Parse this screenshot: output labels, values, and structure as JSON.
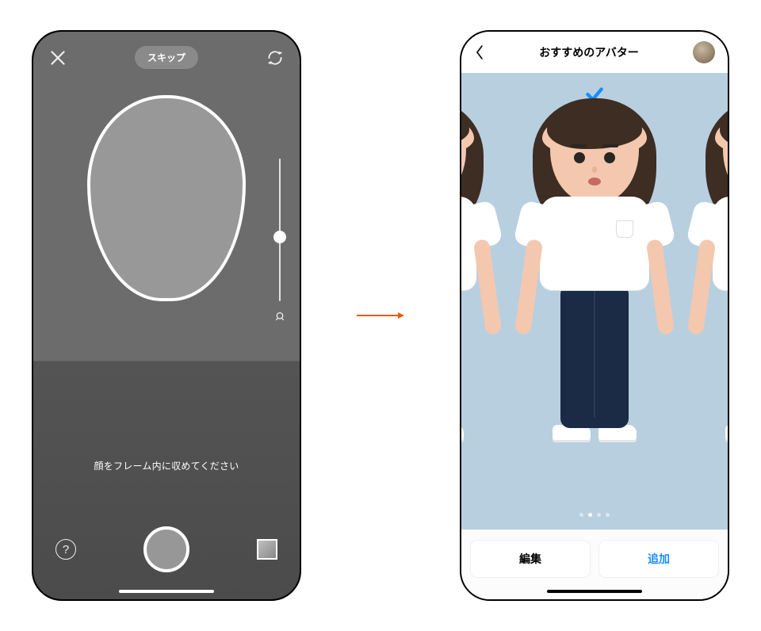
{
  "colors": {
    "accent_blue": "#1a8cff",
    "avatar_stage_bg": "#b8cfe0",
    "arrow": "#e85b17"
  },
  "left_screen": {
    "skip_label": "スキップ",
    "instruction": "顔をフレーム内に収めてください",
    "help_glyph": "?",
    "zoom_value": 0.55
  },
  "right_screen": {
    "title": "おすすめのアバター",
    "pagination": {
      "count": 4,
      "active_index": 1
    },
    "buttons": {
      "edit": "編集",
      "add": "追加"
    }
  }
}
